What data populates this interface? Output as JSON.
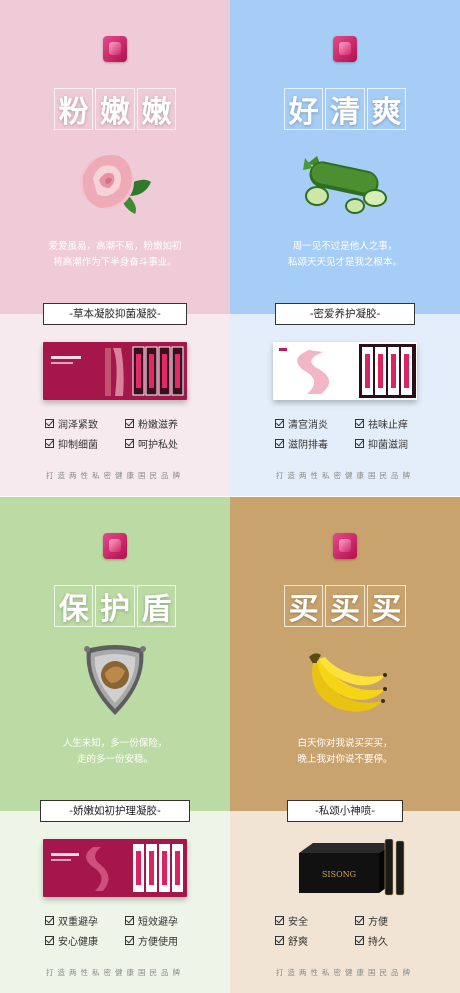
{
  "panels": [
    {
      "title": [
        "粉",
        "嫩",
        "嫩"
      ],
      "illustration": "rose-icon",
      "tagline": [
        "爱爱虽易，高潮不易，粉嫩如初",
        "将高潮作为下半身奋斗事业。"
      ],
      "label": "-草本凝胶抑菌凝胶-",
      "features": [
        "润泽紧致",
        "粉嫩滋养",
        "抑制细菌",
        "呵护私处"
      ],
      "footer": "打造两性私密健康国民品牌",
      "colors": {
        "top": "#efcbd8",
        "bottom": "#f7eaef"
      }
    },
    {
      "title": [
        "好",
        "清",
        "爽"
      ],
      "illustration": "cucumber-icon",
      "tagline": [
        "周一见不过是他人之事，",
        "私颂天天见才是我之根本。"
      ],
      "label": "-密爱养护凝胶-",
      "features": [
        "清宫消炎",
        "祛味止痒",
        "滋阴排毒",
        "抑菌滋润"
      ],
      "footer": "打造两性私密健康国民品牌",
      "colors": {
        "top": "#a6cdf5",
        "bottom": "#e4eefa"
      }
    },
    {
      "title": [
        "保",
        "护",
        "盾"
      ],
      "illustration": "shield-icon",
      "tagline": [
        "人生未知，多一份保险，",
        "走的多一份安稳。"
      ],
      "label": "-娇嫩如初护理凝胶-",
      "features": [
        "双重避孕",
        "短效避孕",
        "安心健康",
        "方便使用"
      ],
      "footer": "打造两性私密健康国民品牌",
      "colors": {
        "top": "#bcdaa4",
        "bottom": "#eef5e8"
      }
    },
    {
      "title": [
        "买",
        "买",
        "买"
      ],
      "illustration": "banana-icon",
      "tagline": [
        "白天你对我说买买买，",
        "晚上我对你说不要停。"
      ],
      "label": "-私颂小神喷-",
      "features": [
        "安全",
        "方便",
        "舒爽",
        "持久"
      ],
      "footer": "打造两性私密健康国民品牌",
      "colors": {
        "top": "#c9a36d",
        "bottom": "#f1e4d5"
      }
    }
  ],
  "brand": "SISONG"
}
